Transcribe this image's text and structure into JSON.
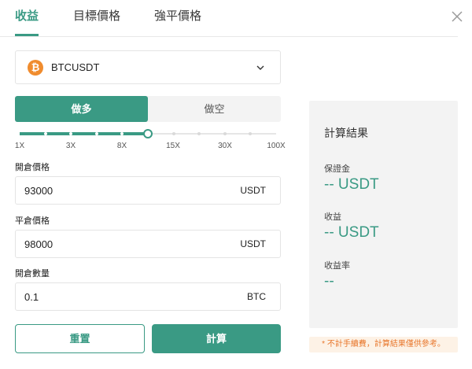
{
  "tabs": [
    {
      "label": "收益",
      "active": true
    },
    {
      "label": "目標價格",
      "active": false
    },
    {
      "label": "強平價格",
      "active": false
    }
  ],
  "pair": {
    "coin_symbol": "₿",
    "label": "BTCUSDT"
  },
  "side": {
    "long_label": "做多",
    "short_label": "做空",
    "selected": "long"
  },
  "leverage": {
    "labels": [
      "1X",
      "3X",
      "8X",
      "15X",
      "30X",
      "100X"
    ],
    "selected": "8X",
    "position_fraction": 0.5
  },
  "fields": {
    "open_price": {
      "label": "開倉價格",
      "value": "93000",
      "unit": "USDT"
    },
    "close_price": {
      "label": "平倉價格",
      "value": "98000",
      "unit": "USDT"
    },
    "quantity": {
      "label": "開倉數量",
      "value": "0.1",
      "unit": "BTC"
    }
  },
  "buttons": {
    "reset": "重置",
    "calculate": "計算"
  },
  "results": {
    "title": "計算結果",
    "margin_label": "保證金",
    "margin_value": "-- USDT",
    "pnl_label": "收益",
    "pnl_value": "-- USDT",
    "roe_label": "收益率",
    "roe_value": "--"
  },
  "note": "* 不計手續費，計算結果僅供參考。",
  "colors": {
    "accent": "#3a9a84",
    "coin": "#f08c2e",
    "note_text": "#e8762b",
    "note_bg": "#fdf2e6"
  }
}
